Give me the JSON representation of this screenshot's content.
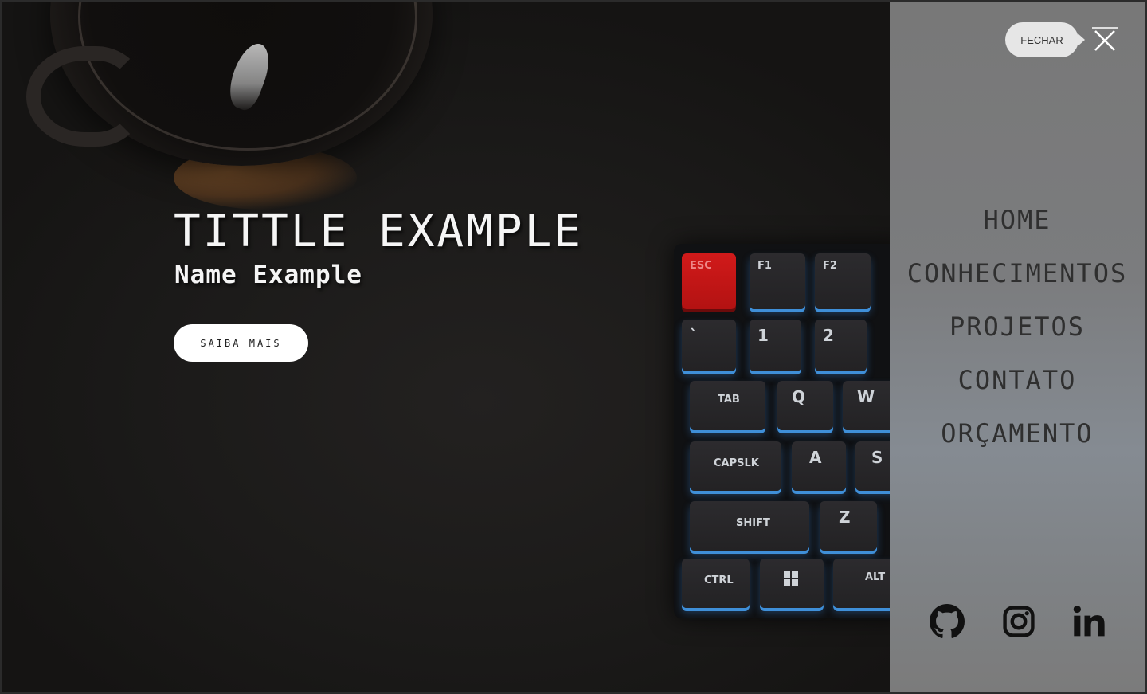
{
  "hero": {
    "title": "TITTLE EXAMPLE",
    "subtitle": "Name Example",
    "cta_label": "SAIBA MAIS"
  },
  "keyboard_keys": [
    "ESC",
    "F1",
    "F2",
    "`",
    "1",
    "2",
    "TAB",
    "Q",
    "W",
    "CAPSLK",
    "A",
    "S",
    "SHIFT",
    "Z",
    "CTRL",
    "ALT"
  ],
  "side_menu": {
    "close_tooltip": "FECHAR",
    "nav_items": [
      {
        "label": "HOME"
      },
      {
        "label": "CONHECIMENTOS"
      },
      {
        "label": "PROJETOS"
      },
      {
        "label": "CONTATO"
      },
      {
        "label": "ORÇAMENTO"
      }
    ],
    "socials": [
      {
        "icon": "github-icon"
      },
      {
        "icon": "instagram-icon"
      },
      {
        "icon": "linkedin-icon"
      }
    ]
  },
  "colors": {
    "menu_text": "#2f2f2f",
    "hero_text": "#f5f5f5",
    "esc_key": "#d11a1a"
  }
}
